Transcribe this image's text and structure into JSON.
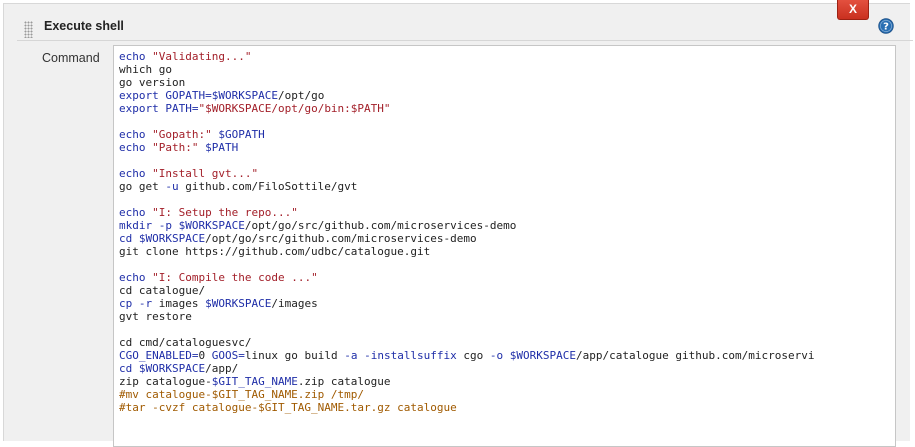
{
  "section": {
    "title": "Execute shell",
    "delete_label": "X"
  },
  "icons": {
    "help": "question-mark-circle-icon",
    "drag": "drag-handle-icon"
  },
  "command": {
    "label": "Command",
    "lines": [
      [
        {
          "t": "echo ",
          "c": "kw"
        },
        {
          "t": "\"Validating...\"",
          "c": "str"
        }
      ],
      [
        {
          "t": "which go",
          "c": ""
        }
      ],
      [
        {
          "t": "go version",
          "c": ""
        }
      ],
      [
        {
          "t": "export ",
          "c": "kw"
        },
        {
          "t": "GOPATH=",
          "c": "var"
        },
        {
          "t": "$WORKSPACE",
          "c": "var"
        },
        {
          "t": "/opt/go",
          "c": ""
        }
      ],
      [
        {
          "t": "export ",
          "c": "kw"
        },
        {
          "t": "PATH=",
          "c": "var"
        },
        {
          "t": "\"$WORKSPACE/opt/go/bin:$PATH\"",
          "c": "str"
        }
      ],
      [],
      [
        {
          "t": "echo ",
          "c": "kw"
        },
        {
          "t": "\"Gopath:\" ",
          "c": "str"
        },
        {
          "t": "$GOPATH",
          "c": "var"
        }
      ],
      [
        {
          "t": "echo ",
          "c": "kw"
        },
        {
          "t": "\"Path:\" ",
          "c": "str"
        },
        {
          "t": "$PATH",
          "c": "var"
        }
      ],
      [],
      [
        {
          "t": "echo ",
          "c": "kw"
        },
        {
          "t": "\"Install gvt...\"",
          "c": "str"
        }
      ],
      [
        {
          "t": "go get ",
          "c": ""
        },
        {
          "t": "-u",
          "c": "flag"
        },
        {
          "t": " github.com/FiloSottile/gvt",
          "c": ""
        }
      ],
      [],
      [
        {
          "t": "echo ",
          "c": "kw"
        },
        {
          "t": "\"I: Setup the repo...\"",
          "c": "str"
        }
      ],
      [
        {
          "t": "mkdir ",
          "c": "kw"
        },
        {
          "t": "-p ",
          "c": "flag"
        },
        {
          "t": "$WORKSPACE",
          "c": "var"
        },
        {
          "t": "/opt/go/src/github.com/microservices-demo",
          "c": ""
        }
      ],
      [
        {
          "t": "cd ",
          "c": "kw"
        },
        {
          "t": "$WORKSPACE",
          "c": "var"
        },
        {
          "t": "/opt/go/src/github.com/microservices-demo",
          "c": ""
        }
      ],
      [
        {
          "t": "git clone https://github.com/udbc/catalogue.git",
          "c": ""
        }
      ],
      [],
      [
        {
          "t": "echo ",
          "c": "kw"
        },
        {
          "t": "\"I: Compile the code ...\"",
          "c": "str"
        }
      ],
      [
        {
          "t": "cd catalogue/",
          "c": ""
        }
      ],
      [
        {
          "t": "cp ",
          "c": "kw"
        },
        {
          "t": "-r",
          "c": "flag"
        },
        {
          "t": " images ",
          "c": ""
        },
        {
          "t": "$WORKSPACE",
          "c": "var"
        },
        {
          "t": "/images",
          "c": ""
        }
      ],
      [
        {
          "t": "gvt restore",
          "c": ""
        }
      ],
      [],
      [
        {
          "t": "cd cmd/cataloguesvc/",
          "c": ""
        }
      ],
      [
        {
          "t": "CGO_ENABLED=",
          "c": "var"
        },
        {
          "t": "0 ",
          "c": ""
        },
        {
          "t": "GOOS=",
          "c": "var"
        },
        {
          "t": "linux go build ",
          "c": ""
        },
        {
          "t": "-a ",
          "c": "flag"
        },
        {
          "t": "-installsuffix",
          "c": "flag"
        },
        {
          "t": " cgo ",
          "c": ""
        },
        {
          "t": "-o ",
          "c": "flag"
        },
        {
          "t": "$WORKSPACE",
          "c": "var"
        },
        {
          "t": "/app/catalogue github.com/microservi",
          "c": ""
        }
      ],
      [
        {
          "t": "cd ",
          "c": "kw"
        },
        {
          "t": "$WORKSPACE",
          "c": "var"
        },
        {
          "t": "/app/",
          "c": ""
        }
      ],
      [
        {
          "t": "zip catalogue-",
          "c": ""
        },
        {
          "t": "$GIT_TAG_NAME",
          "c": "var"
        },
        {
          "t": ".zip catalogue",
          "c": ""
        }
      ],
      [
        {
          "t": "#mv catalogue-$GIT_TAG_NAME.zip /tmp/",
          "c": "cmt"
        }
      ],
      [
        {
          "t": "#tar -cvzf catalogue-$GIT_TAG_NAME.tar.gz catalogue",
          "c": "cmt"
        }
      ]
    ]
  },
  "colors": {
    "delete_button": "#d23a28",
    "help_icon": "#2a6fb3",
    "keyword": "#1f2ea8",
    "string": "#a3202a",
    "comment": "#a05a00"
  }
}
